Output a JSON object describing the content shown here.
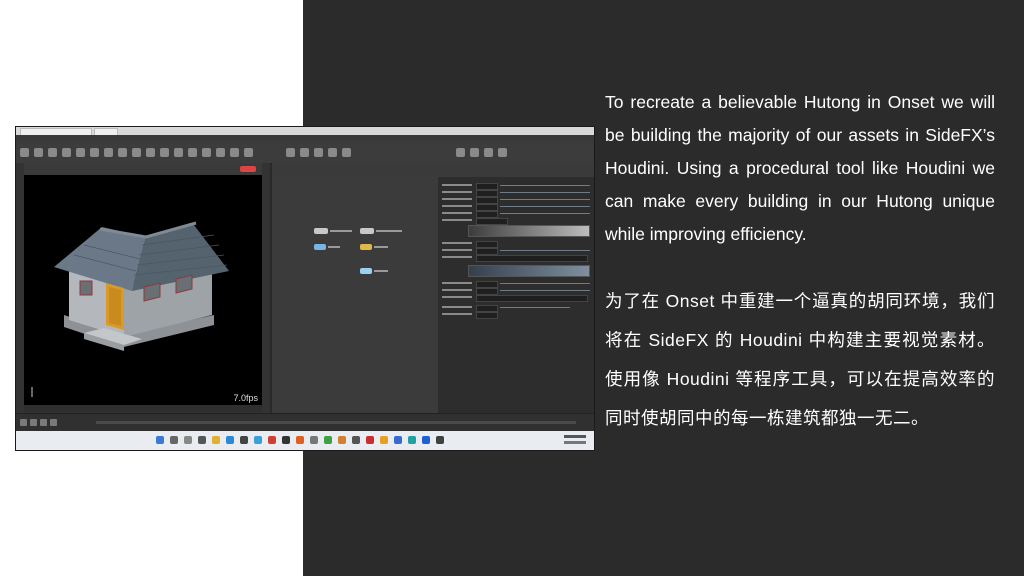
{
  "viewport": {
    "fps": "7.0fps"
  },
  "body_text": {
    "english": "To recreate a believable Hutong in Onset we will be building the majority of our assets in SideFX’s Houdini. Using a procedural tool like Houdini we can make every building in our Hutong unique while improving efficiency.",
    "chinese": "为了在 Onset 中重建一个逼真的胡同环境，我们将在 SideFX 的 Houdini 中构建主要视觉素材。使用像 Houdini 等程序工具，可以在提高效率的同时使胡同中的每一栋建筑都独一无二。"
  },
  "colors": {
    "panel_background": "#2b2b2b",
    "page_background": "#ffffff",
    "text": "#ffffff",
    "door": "#d89a2a",
    "roof": "#5d6b7a",
    "walls": "#a9adb2"
  }
}
